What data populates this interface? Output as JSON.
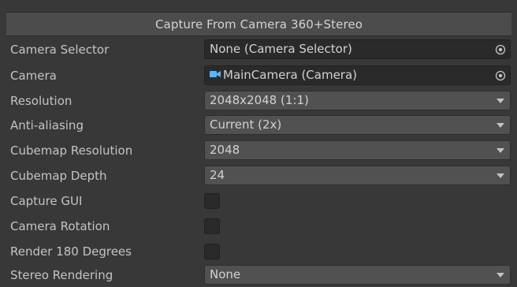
{
  "header": {
    "title": "Capture From Camera 360+Stereo"
  },
  "rows": {
    "camera_selector": {
      "label": "Camera Selector",
      "value": "None (Camera Selector)"
    },
    "camera": {
      "label": "Camera",
      "value": "MainCamera (Camera)"
    },
    "resolution": {
      "label": "Resolution",
      "value": "2048x2048 (1:1)"
    },
    "anti_aliasing": {
      "label": "Anti-aliasing",
      "value": "Current (2x)"
    },
    "cubemap_resolution": {
      "label": "Cubemap Resolution",
      "value": "2048"
    },
    "cubemap_depth": {
      "label": "Cubemap Depth",
      "value": "24"
    },
    "capture_gui": {
      "label": "Capture GUI",
      "checked": false
    },
    "camera_rotation": {
      "label": "Camera Rotation",
      "checked": false
    },
    "render_180": {
      "label": "Render 180 Degrees",
      "checked": false
    },
    "stereo_rendering": {
      "label": "Stereo Rendering",
      "value": "None"
    }
  },
  "icons": {
    "object_picker": "target-circle-icon",
    "camera_component": "camera-icon",
    "dropdown_arrow": "chevron-down-icon"
  },
  "colors": {
    "background": "#383838",
    "header": "#4c4c4c",
    "field_dark": "#2a2a2a",
    "dropdown": "#515151",
    "text": "#c4c4c4",
    "camera_icon": "#5ab4ff"
  }
}
